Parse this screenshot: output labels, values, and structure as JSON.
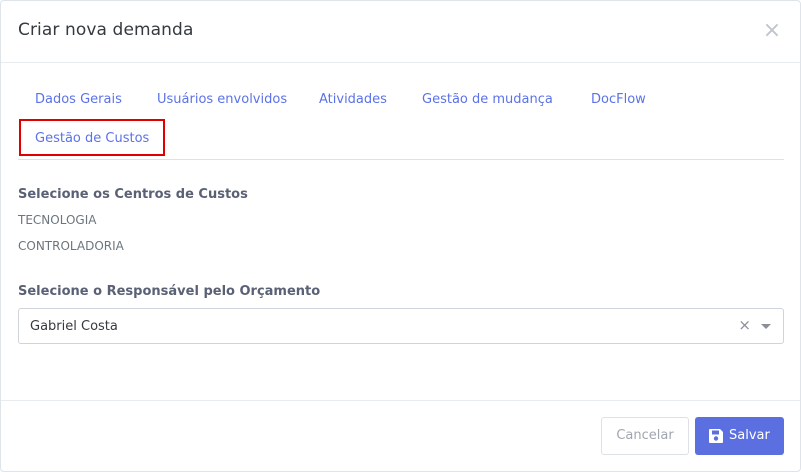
{
  "modal": {
    "title": "Criar nova demanda",
    "close_icon": "close-icon"
  },
  "tabs": [
    {
      "label": "Dados Gerais"
    },
    {
      "label": "Usuários envolvidos"
    },
    {
      "label": "Atividades"
    },
    {
      "label": "Gestão de mudança"
    },
    {
      "label": "DocFlow"
    },
    {
      "label": "Gestão de Custos",
      "active": true
    }
  ],
  "cost_centers": {
    "label": "Selecione os Centros de Custos",
    "items": [
      "TECNOLOGIA",
      "CONTROLADORIA"
    ]
  },
  "budget_owner": {
    "label": "Selecione o Responsável pelo Orçamento",
    "selected": "Gabriel Costa"
  },
  "footer": {
    "cancel_label": "Cancelar",
    "save_label": "Salvar"
  },
  "colors": {
    "accent": "#5b6fe0",
    "tab_link": "#5b72e8",
    "highlight": "#e00000"
  },
  "icons": [
    "close-icon",
    "clear-icon",
    "chevron-down-icon",
    "save-icon"
  ]
}
